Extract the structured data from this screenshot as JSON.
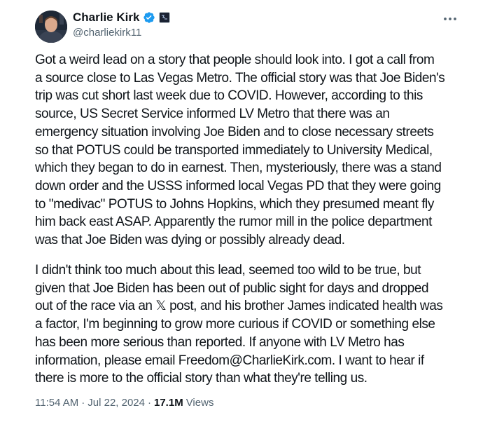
{
  "author": {
    "display_name": "Charlie Kirk",
    "handle": "@charliekirk11"
  },
  "icons": {
    "verified": "verified-badge-icon",
    "affiliate": "affiliate-badge-icon",
    "more": "more-options-icon",
    "accent": "#1d9bf0"
  },
  "tweet": {
    "paragraph_1": "Got a weird lead on a story that people should look into. I got a call from\na source close to Las Vegas Metro. The official story was that Joe Biden's\ntrip was cut short last week due to COVID. However, according to this\nsource, US Secret Service informed LV Metro that there was an\nemergency situation involving Joe Biden and to close necessary streets\nso that POTUS could be transported immediately to University Medical,\nwhich they began to do in earnest. Then, mysteriously, there was a stand\ndown order and the USSS informed local Vegas PD that they were going\nto \"medivac\" POTUS to Johns Hopkins, which they presumed meant fly\nhim back east ASAP. Apparently the rumor mill in the police department\nwas that Joe Biden was dying or possibly already dead.",
    "paragraph_2": "I didn't think too much about this lead, seemed too wild to be true, but\ngiven that Joe Biden has been out of public sight for days and dropped\nout of the race via an 𝕏 post, and his brother James indicated health was\na factor, I'm beginning to grow more curious if COVID or something else\nhas been more serious than reported. If anyone with LV Metro has\ninformation, please email Freedom@CharlieKirk.com. I want to hear if\nthere is more to the official story than what they're telling us."
  },
  "meta": {
    "time": "11:54 AM",
    "separator": "·",
    "date": "Jul 22, 2024",
    "views_count": "17.1M",
    "views_label": "Views"
  }
}
